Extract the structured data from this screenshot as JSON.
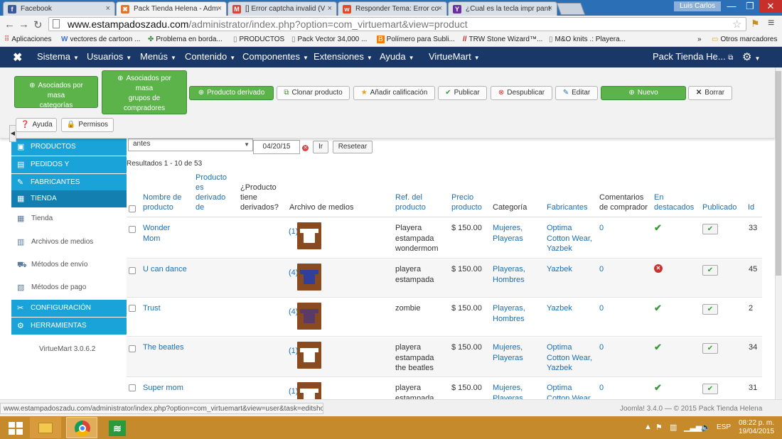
{
  "browser": {
    "tabs": [
      {
        "title": "Facebook",
        "favicon": "f",
        "favicon_color": "#3b5998",
        "active": false
      },
      {
        "title": "Pack Tienda Helena - Adm",
        "favicon": "✖",
        "favicon_color": "#e8732a",
        "active": true
      },
      {
        "title": "[] Error captcha invalid (V",
        "favicon": "M",
        "favicon_color": "#d44638",
        "active": false
      },
      {
        "title": "Responder Tema: Error co",
        "favicon": "w",
        "favicon_color": "#e04a2a",
        "active": false
      },
      {
        "title": "¿Cual es la tecla impr pant",
        "favicon": "Y",
        "favicon_color": "#6b2fa0",
        "active": false
      }
    ],
    "window_user": "Luis Carlos",
    "window_controls": [
      "—",
      "❐",
      "✕"
    ],
    "url_host": "www.estampadoszadu.com",
    "url_path": "/administrator/index.php?option=com_virtuemart&view=product",
    "bookmarks": [
      {
        "label": "Aplicaciones",
        "icon": "apps-icon"
      },
      {
        "label": "vectores de cartoon ...",
        "icon": "w-icon"
      },
      {
        "label": "Problema en borda...",
        "icon": "puzzle-icon"
      },
      {
        "label": "PRODUCTOS",
        "icon": "page-icon"
      },
      {
        "label": "Pack Vector 34,000 ...",
        "icon": "page-icon"
      },
      {
        "label": "Polímero para Subli...",
        "icon": "blogger-icon"
      },
      {
        "label": "TRW Stone Wizard™...",
        "icon": "trw-icon"
      },
      {
        "label": "M&O knits .: Playera...",
        "icon": "page-icon"
      }
    ],
    "bookmarks_more": "»",
    "other_bookmarks": "Otros marcadores"
  },
  "admin_menu": {
    "items": [
      {
        "label": "Sistema",
        "has_caret": true
      },
      {
        "label": "Usuarios",
        "has_caret": true
      },
      {
        "label": "Menús",
        "has_caret": true
      },
      {
        "label": "Contenido",
        "has_caret": true
      },
      {
        "label": "Componentes",
        "has_caret": true
      },
      {
        "label": "Extensiones",
        "has_caret": true
      },
      {
        "label": "Ayuda",
        "has_caret": true
      },
      {
        "label": "VirtueMart",
        "has_caret": true
      }
    ],
    "site_name": "Pack Tienda He...",
    "site_link_icon": "⧉"
  },
  "toolbar": {
    "buttons": [
      {
        "label": "Asociados por masa categorías",
        "lines": [
          "Asociados por",
          "masa",
          "categorías"
        ],
        "style": "green",
        "icon": "plus-circle-icon"
      },
      {
        "label": "Asociados por masa grupos de compradores",
        "lines": [
          "Asociados por",
          "masa",
          "grupos de",
          "compradores"
        ],
        "style": "green",
        "icon": "plus-circle-icon"
      },
      {
        "label": "Producto derivado",
        "style": "green",
        "icon": "plus-circle-icon"
      },
      {
        "label": "Clonar producto",
        "style": "default",
        "icon": "copy-icon"
      },
      {
        "label": "Añadir calificación",
        "style": "default",
        "icon": "star-icon"
      },
      {
        "label": "Publicar",
        "style": "default",
        "icon": "check-icon"
      },
      {
        "label": "Despublicar",
        "style": "default",
        "icon": "cancel-circle-icon"
      },
      {
        "label": "Editar",
        "style": "default",
        "icon": "edit-icon"
      },
      {
        "label": "Nuevo",
        "style": "green",
        "icon": "plus-circle-icon"
      },
      {
        "label": "Borrar",
        "style": "default",
        "icon": "x-icon"
      },
      {
        "label": "Ayuda",
        "style": "default",
        "icon": "question-icon"
      },
      {
        "label": "Permisos",
        "style": "default",
        "icon": "lock-icon"
      }
    ]
  },
  "sidebar": {
    "sections": [
      {
        "label": "PRODUCTOS",
        "icon": "box-icon",
        "active": false
      },
      {
        "label": "PEDIDOS Y",
        "icon": "orders-icon",
        "active": false
      },
      {
        "label": "FABRICANTES",
        "icon": "wrench-icon",
        "active": false
      },
      {
        "label": "TIENDA",
        "icon": "store-icon",
        "active": true
      }
    ],
    "items": [
      {
        "label": "Tienda",
        "icon": "store-small-icon"
      },
      {
        "label": "Archivos de medios",
        "icon": "media-icon"
      },
      {
        "label": "Métodos de envío",
        "icon": "truck-icon"
      },
      {
        "label": "Métodos de pago",
        "icon": "payment-icon"
      }
    ],
    "sections2": [
      {
        "label": "CONFIGURACIÓN",
        "icon": "tools-icon"
      },
      {
        "label": "HERRAMIENTAS",
        "icon": "gear-small-icon"
      }
    ],
    "version": "VirtueMart 3.0.6.2"
  },
  "filters": {
    "select_value": "antes",
    "date_value": "04/20/15",
    "go_label": "Ir",
    "reset_label": "Resetear",
    "results_text": "Resultados 1 - 10 de 53"
  },
  "table": {
    "headers": {
      "name": "Nombre de producto",
      "derived": "Producto es derivado de",
      "has_derived": "¿Producto tiene derivados?",
      "media": "Archivo de medios",
      "ref": "Ref. del producto",
      "price": "Precio producto",
      "category": "Categoría",
      "manufacturer": "Fabricantes",
      "comments": "Comentarios de comprador",
      "featured": "En destacados",
      "published": "Publicado",
      "id": "Id"
    },
    "rows": [
      {
        "name": "Wonder Mom",
        "media": "(1)",
        "ref": "Playera estampada wondermom",
        "price": "$ 150.00",
        "category": "Mujeres, Playeras",
        "manufacturer": "Optima Cotton Wear, Yazbek",
        "comments": "0",
        "featured": true,
        "published": true,
        "id": "33",
        "thumb_color": "#ffffff"
      },
      {
        "name": "U can dance",
        "media": "(4)",
        "ref": "playera estampada",
        "price": "$ 150.00",
        "category": "Playeras, Hombres",
        "manufacturer": "Yazbek",
        "comments": "0",
        "featured": false,
        "published": true,
        "id": "45",
        "thumb_color": "#2f3f9a"
      },
      {
        "name": "Trust",
        "media": "(4)",
        "ref": "zombie",
        "price": "$ 150.00",
        "category": "Playeras, Hombres",
        "manufacturer": "Yazbek",
        "comments": "0",
        "featured": true,
        "published": true,
        "id": "2",
        "thumb_color": "#5a3a6a"
      },
      {
        "name": "The beatles",
        "media": "(1)",
        "ref": "playera estampada the beatles",
        "price": "$ 150.00",
        "category": "Mujeres, Playeras",
        "manufacturer": "Optima Cotton Wear, Yazbek",
        "comments": "0",
        "featured": true,
        "published": true,
        "id": "34",
        "thumb_color": "#ffffff"
      },
      {
        "name": "Super mom",
        "media": "(1)",
        "ref": "playera estampada",
        "price": "$ 150.00",
        "category": "Mujeres, Playeras",
        "manufacturer": "Optima Cotton Wear",
        "comments": "0",
        "featured": true,
        "published": true,
        "id": "31",
        "thumb_color": "#ffffff"
      }
    ]
  },
  "status": {
    "url": "www.estampadoszadu.com/administrator/index.php?option=com_virtuemart&view=user&task=editshop",
    "footer": "Joomla! 3.4.0  —  © 2015 Pack Tienda Helena"
  },
  "taskbar": {
    "lang": "ESP",
    "time": "08:22 p. m.",
    "date": "19/04/2015"
  },
  "colors": {
    "admin_bar": "#1a3867",
    "sidebar_blue": "#1aa3d9",
    "green_button": "#5bb34a",
    "link": "#1a6fb6",
    "taskbar": "#c48a2c"
  }
}
